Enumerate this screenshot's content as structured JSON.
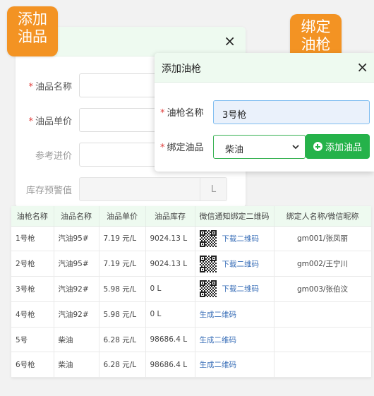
{
  "tag_product": "添加\n油品",
  "tag_bind": "绑定\n油枪",
  "add_product_dialog": {
    "close": "×",
    "fields": [
      {
        "label": "油品名称",
        "required": true
      },
      {
        "label": "油品单价",
        "required": true
      },
      {
        "label": "参考进价",
        "required": false
      },
      {
        "label": "库存预警值",
        "required": false,
        "unit": "L"
      }
    ]
  },
  "add_nozzle_dialog": {
    "title": "添加油枪",
    "close": "×",
    "name_label": "油枪名称",
    "name_value": "3号枪",
    "bind_label": "绑定油品",
    "bind_value": "柴油",
    "add_button": "添加油品"
  },
  "table": {
    "headers": [
      "油枪名称",
      "油品名称",
      "油品单价",
      "油品库存",
      "微信通知绑定二维码",
      "绑定人名称/微信昵称"
    ],
    "rows": [
      {
        "nozzle": "1号枪",
        "product": "汽油95#",
        "price": "7.19 元/L",
        "stock": "9024.13 L",
        "qr": true,
        "action": "下载二维码",
        "user": "gm001/张凤丽"
      },
      {
        "nozzle": "2号枪",
        "product": "汽油95#",
        "price": "7.19 元/L",
        "stock": "9024.13 L",
        "qr": true,
        "action": "下载二维码",
        "user": "gm002/王宁川"
      },
      {
        "nozzle": "3号枪",
        "product": "汽油92#",
        "price": "5.98 元/L",
        "stock": "0 L",
        "qr": true,
        "action": "下载二维码",
        "user": "gm003/张伯汶"
      },
      {
        "nozzle": "4号枪",
        "product": "汽油92#",
        "price": "5.98 元/L",
        "stock": "0 L",
        "qr": false,
        "action": "生成二维码",
        "user": ""
      },
      {
        "nozzle": "5号",
        "product": "柴油",
        "price": "6.28 元/L",
        "stock": "98686.4 L",
        "qr": false,
        "action": "生成二维码",
        "user": ""
      },
      {
        "nozzle": "6号枪",
        "product": "柴油",
        "price": "6.28 元/L",
        "stock": "98686.4 L",
        "qr": false,
        "action": "生成二维码",
        "user": ""
      }
    ]
  },
  "colors": {
    "accent_green": "#25b24a",
    "tag_orange": "#f39323",
    "link_blue": "#3a6fb8"
  }
}
